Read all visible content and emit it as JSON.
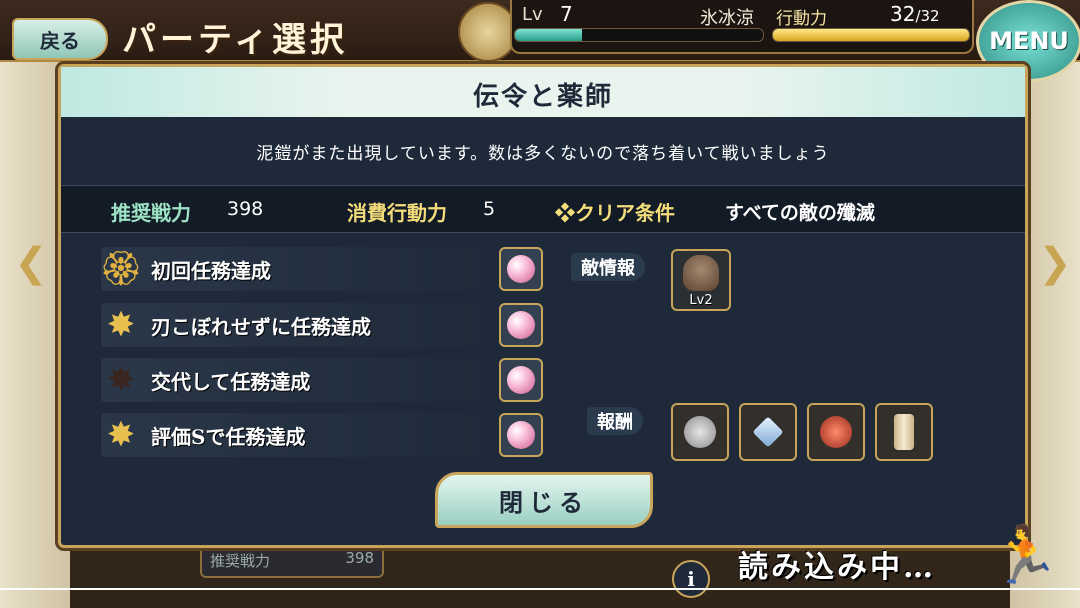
{
  "header": {
    "back_label": "戻る",
    "screen_title": "パーティ選択",
    "menu_label": "MENU"
  },
  "status": {
    "level_label": "Lv",
    "level": "7",
    "level_progress": 0.27,
    "player_name": "氷冰涼",
    "stamina_label": "行動力",
    "stamina_current": "32",
    "stamina_max": "/32",
    "stamina_progress": 1.0
  },
  "dialog": {
    "title": "伝令と薬師",
    "description": "泥鎧がまた出現しています。数は多くないので落ち着いて戦いましょう",
    "recommended_power_label": "推奨戦力",
    "recommended_power": "398",
    "stamina_cost_label": "消費行動力",
    "stamina_cost": "5",
    "clear_condition_label": "❖クリア条件",
    "clear_condition": "すべての敵の殲滅",
    "missions": [
      {
        "label": "初回任務達成",
        "medal": "red-gold-medal-icon"
      },
      {
        "label": "刃こぼれせずに任務達成",
        "medal": "gold-star-medal-icon"
      },
      {
        "label": "交代して任務達成",
        "medal": "dark-star-medal-icon"
      },
      {
        "label": "評価Sで任務達成",
        "medal": "gold-star-medal-icon"
      }
    ],
    "enemy_info_label": "敵情報",
    "enemy_level": "Lv2",
    "rewards_label": "報酬",
    "rewards": [
      "charm-icon",
      "blade-shard-icon",
      "red-item-icon",
      "scroll-icon"
    ],
    "close_label": "閉じる"
  },
  "background": {
    "power_label": "推奨戦力",
    "power_value": "398"
  },
  "loading_text": "読み込み中…",
  "colors": {
    "accent_teal": "#7fe3d2",
    "gold": "#c8a55b",
    "panel": "#1e2a3a",
    "label_green": "#9de2c4",
    "label_yellow": "#f3dc7a"
  }
}
